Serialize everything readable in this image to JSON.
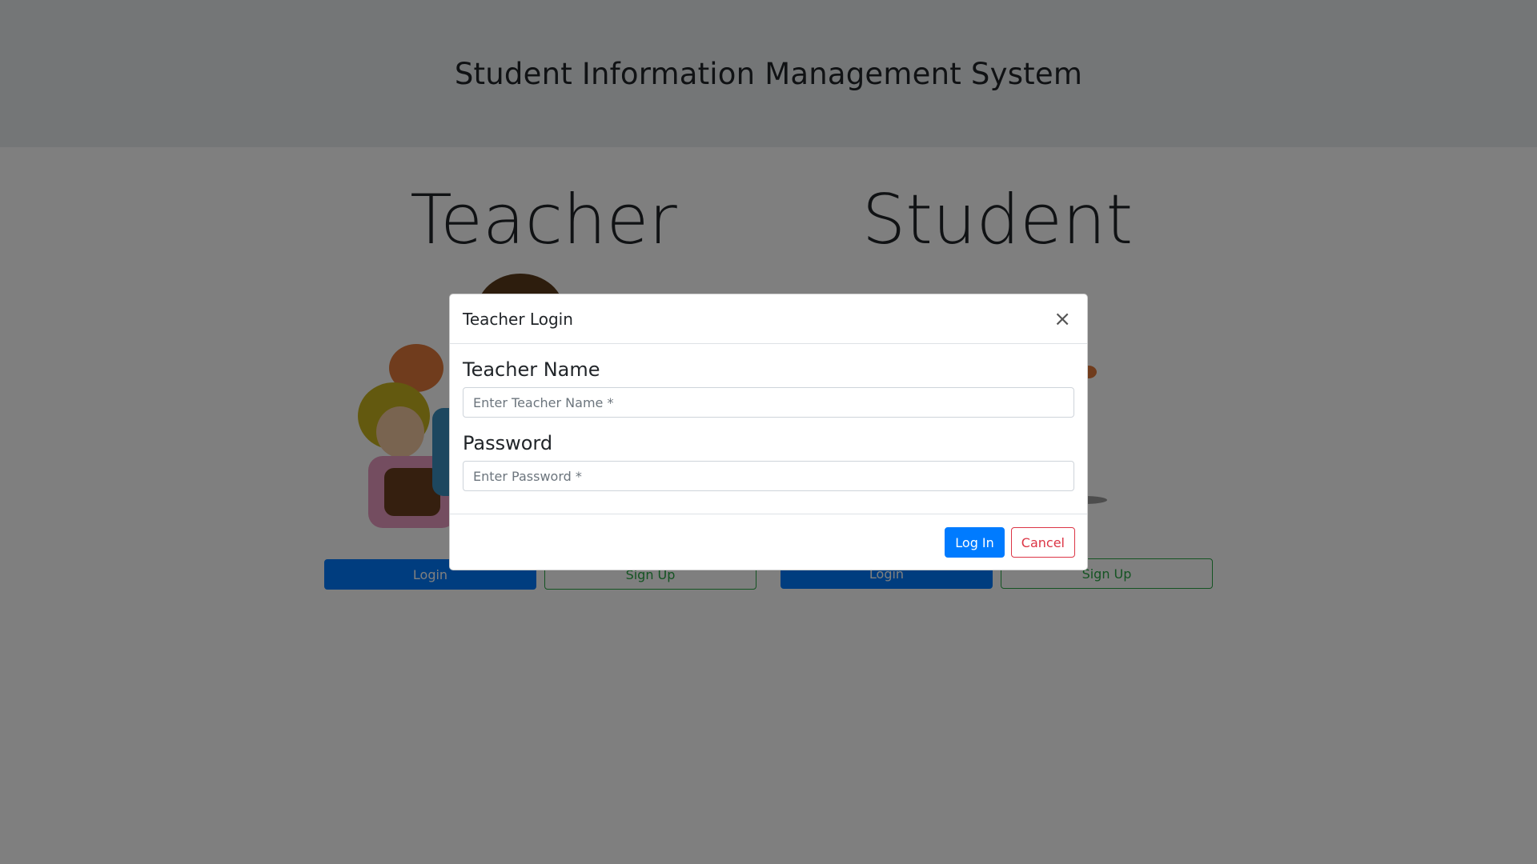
{
  "header": {
    "title": "Student Information Management System"
  },
  "teacher": {
    "title": "Teacher",
    "login_label": "Login",
    "signup_label": "Sign Up"
  },
  "student": {
    "title": "Student",
    "login_label": "Login",
    "signup_label": "Sign Up"
  },
  "modal": {
    "title": "Teacher Login",
    "name_label": "Teacher Name",
    "name_placeholder": "Enter Teacher Name *",
    "password_label": "Password",
    "password_placeholder": "Enter Password *",
    "login_button": "Log In",
    "cancel_button": "Cancel",
    "close_icon": "×"
  },
  "colors": {
    "primary": "#007bff",
    "success": "#28a745",
    "danger": "#dc3545",
    "header_bg": "#e9ecef"
  }
}
